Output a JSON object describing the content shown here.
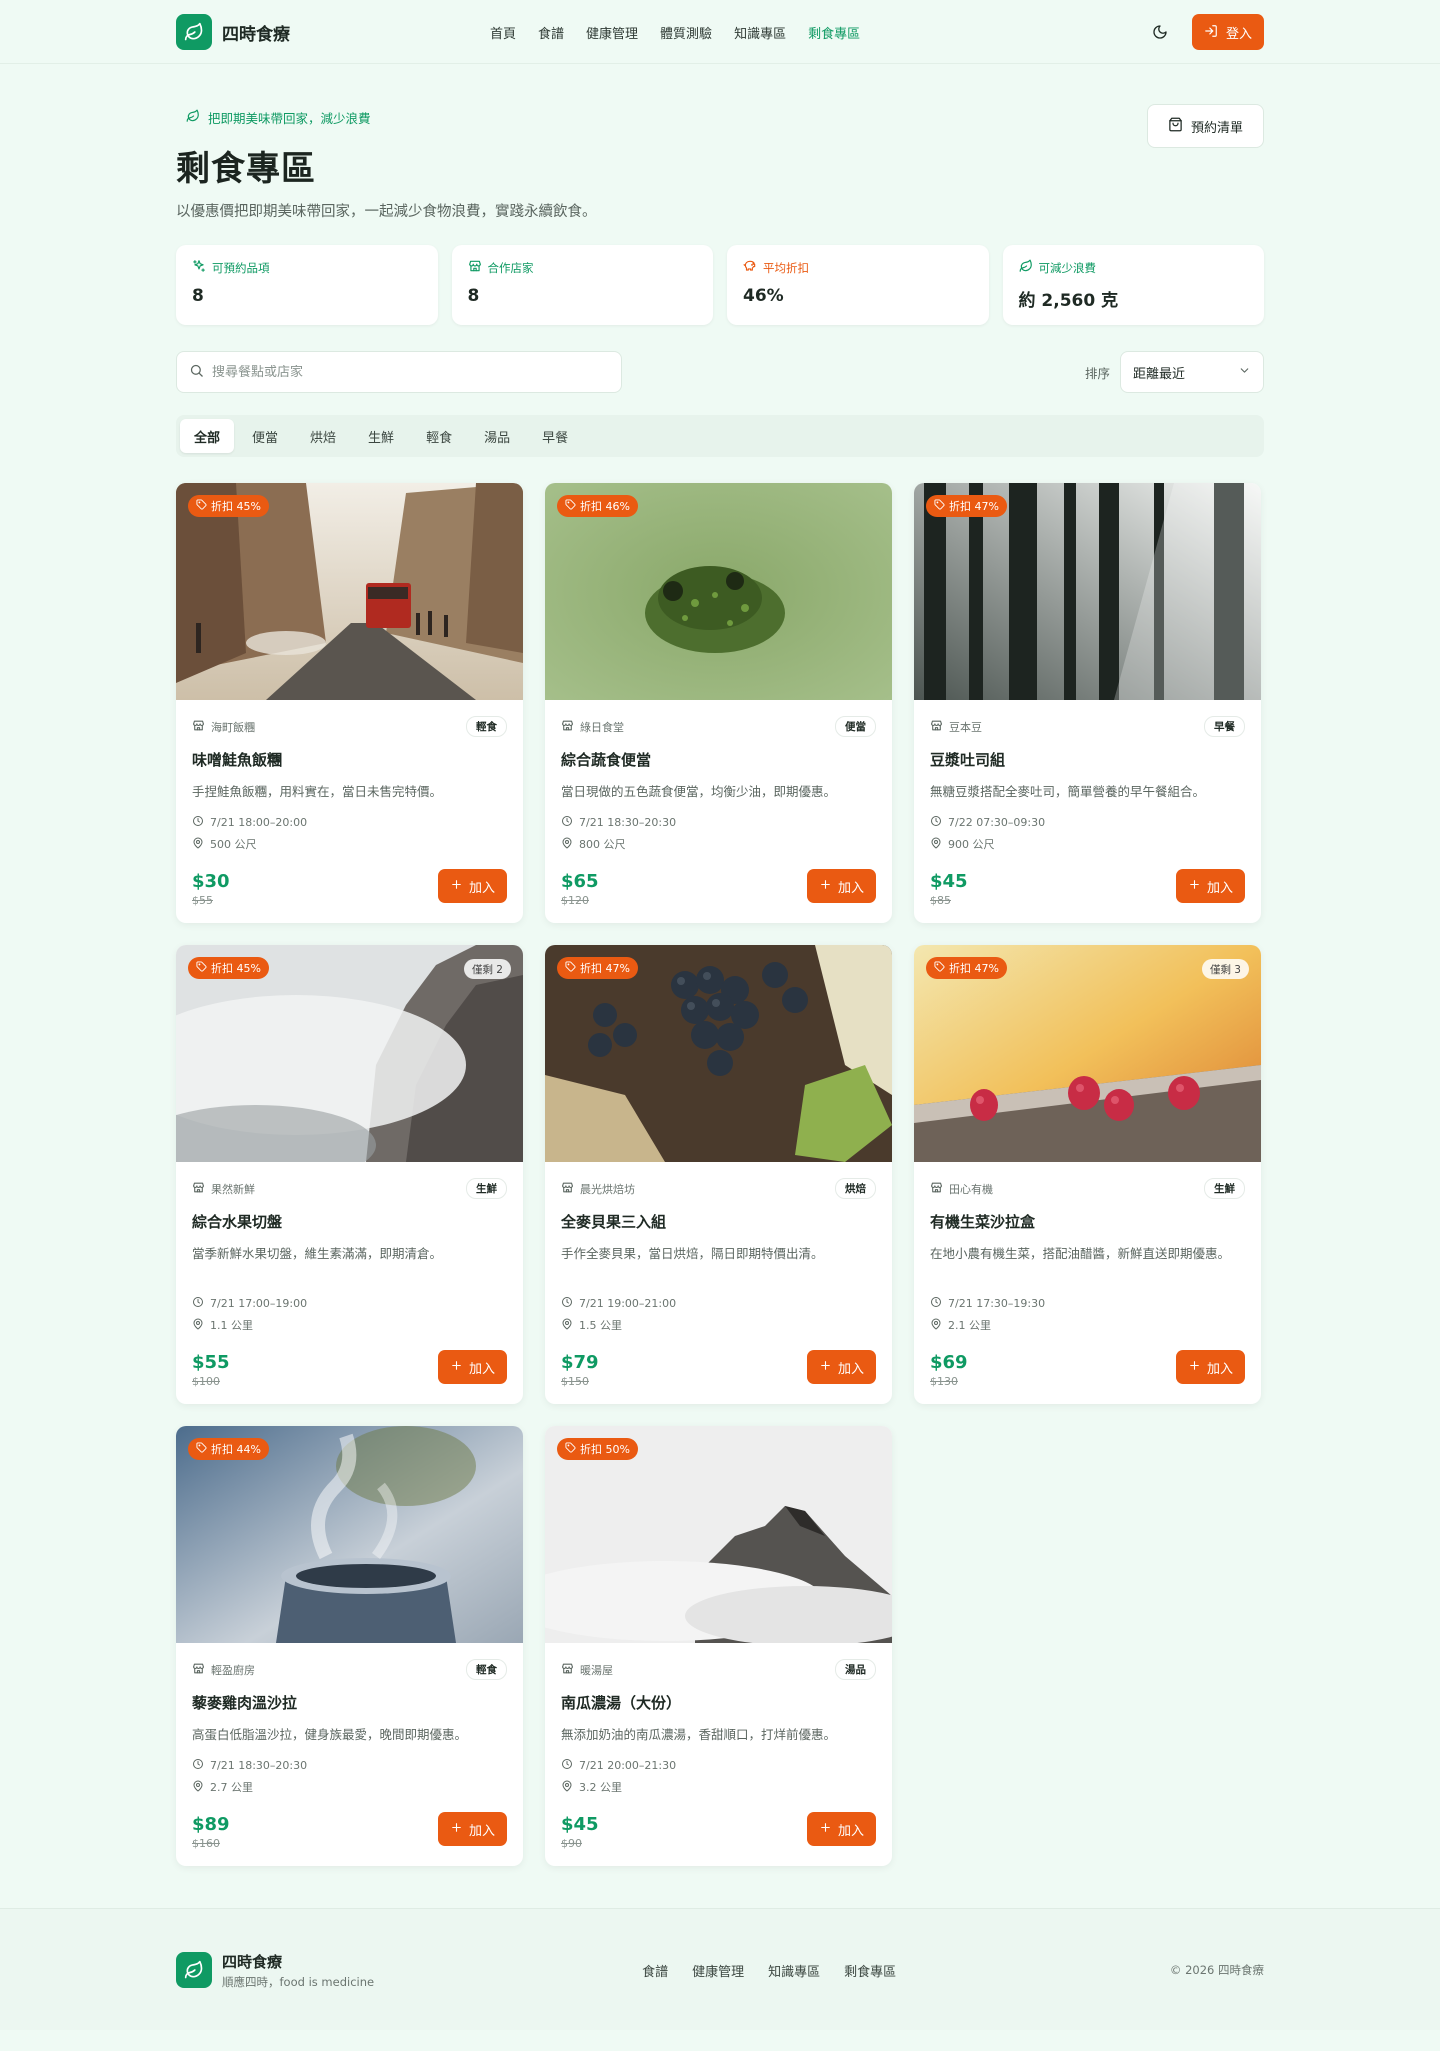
{
  "header": {
    "brand": "四時食療",
    "nav": [
      {
        "label": "首頁",
        "active": false
      },
      {
        "label": "食譜",
        "active": false
      },
      {
        "label": "健康管理",
        "active": false
      },
      {
        "label": "體質測驗",
        "active": false
      },
      {
        "label": "知識專區",
        "active": false
      },
      {
        "label": "剩食專區",
        "active": true
      }
    ],
    "login_label": "登入"
  },
  "hero": {
    "tag": "把即期美味帶回家，減少浪費",
    "title": "剩食專區",
    "subtitle": "以優惠價把即期美味帶回家，一起減少食物浪費，實踐永續飲食。",
    "booking_label": "預約清單"
  },
  "stats": [
    {
      "label": "可預約品項",
      "value": "8",
      "color": "#0f9a63",
      "icon": "sparkle-icon"
    },
    {
      "label": "合作店家",
      "value": "8",
      "color": "#0f9a63",
      "icon": "store-icon"
    },
    {
      "label": "平均折扣",
      "value": "46%",
      "color": "#ea5a12",
      "icon": "piggy-bank-icon"
    },
    {
      "label": "可減少浪費",
      "value": "約 2,560 克",
      "color": "#0f9a63",
      "icon": "leaf-icon"
    }
  ],
  "search": {
    "placeholder": "搜尋餐點或店家"
  },
  "sort": {
    "label": "排序",
    "selected": "距離最近"
  },
  "categories": [
    {
      "label": "全部",
      "active": true
    },
    {
      "label": "便當",
      "active": false
    },
    {
      "label": "烘焙",
      "active": false
    },
    {
      "label": "生鮮",
      "active": false
    },
    {
      "label": "輕食",
      "active": false
    },
    {
      "label": "湯品",
      "active": false
    },
    {
      "label": "早餐",
      "active": false
    }
  ],
  "products": [
    {
      "discount": "折扣 45%",
      "remaining": "",
      "image": "city-street",
      "store": "海町飯糰",
      "category": "輕食",
      "name": "味噌鮭魚飯糰",
      "desc": "手捏鮭魚飯糰，用料實在，當日未售完特價。",
      "time": "7/21 18:00–20:00",
      "distance": "500 公尺",
      "price": "$30",
      "original": "$55",
      "add_label": "加入"
    },
    {
      "discount": "折扣 46%",
      "remaining": "",
      "image": "frog-pond",
      "store": "綠日食堂",
      "category": "便當",
      "name": "綜合蔬食便當",
      "desc": "當日現做的五色蔬食便當，均衡少油，即期優惠。",
      "time": "7/21 18:30–20:30",
      "distance": "800 公尺",
      "price": "$65",
      "original": "$120",
      "add_label": "加入"
    },
    {
      "discount": "折扣 47%",
      "remaining": "",
      "image": "forest",
      "store": "豆本豆",
      "category": "早餐",
      "name": "豆漿吐司組",
      "desc": "無糖豆漿搭配全麥吐司，簡單營養的早午餐組合。",
      "time": "7/22 07:30–09:30",
      "distance": "900 公尺",
      "price": "$45",
      "original": "$85",
      "add_label": "加入"
    },
    {
      "discount": "折扣 45%",
      "remaining": "僅剩 2",
      "image": "misty-cliff",
      "store": "果然新鮮",
      "category": "生鮮",
      "name": "綜合水果切盤",
      "desc": "當季新鮮水果切盤，維生素滿滿，即期清倉。",
      "time": "7/21 17:00–19:00",
      "distance": "1.1 公里",
      "price": "$55",
      "original": "$100",
      "add_label": "加入"
    },
    {
      "discount": "折扣 47%",
      "remaining": "",
      "image": "grapes",
      "store": "晨光烘焙坊",
      "category": "烘焙",
      "name": "全麥貝果三入組",
      "desc": "手作全麥貝果，當日烘焙，隔日即期特價出清。",
      "time": "7/21 19:00–21:00",
      "distance": "1.5 公里",
      "price": "$79",
      "original": "$150",
      "add_label": "加入"
    },
    {
      "discount": "折扣 47%",
      "remaining": "僅剩 3",
      "image": "raspberries",
      "store": "田心有機",
      "category": "生鮮",
      "name": "有機生菜沙拉盒",
      "desc": "在地小農有機生菜，搭配油醋醬，新鮮直送即期優惠。",
      "time": "7/21 17:30–19:30",
      "distance": "2.1 公里",
      "price": "$69",
      "original": "$130",
      "add_label": "加入"
    },
    {
      "discount": "折扣 44%",
      "remaining": "",
      "image": "steaming-cup",
      "store": "輕盈廚房",
      "category": "輕食",
      "name": "藜麥雞肉溫沙拉",
      "desc": "高蛋白低脂溫沙拉，健身族最愛，晚間即期優惠。",
      "time": "7/21 18:30–20:30",
      "distance": "2.7 公里",
      "price": "$89",
      "original": "$160",
      "add_label": "加入"
    },
    {
      "discount": "折扣 50%",
      "remaining": "",
      "image": "foggy-mountain",
      "store": "暖湯屋",
      "category": "湯品",
      "name": "南瓜濃湯（大份）",
      "desc": "無添加奶油的南瓜濃湯，香甜順口，打烊前優惠。",
      "time": "7/21 20:00–21:30",
      "distance": "3.2 公里",
      "price": "$45",
      "original": "$90",
      "add_label": "加入"
    }
  ],
  "footer": {
    "brand": "四時食療",
    "slogan": "順應四時，food is medicine",
    "links": [
      "食譜",
      "健康管理",
      "知識專區",
      "剩食專區"
    ],
    "copyright": "© 2026 四時食療"
  },
  "colors": {
    "brand_green": "#0f9a63",
    "accent_orange": "#ea5a12",
    "page_bg": "#effaf4"
  }
}
